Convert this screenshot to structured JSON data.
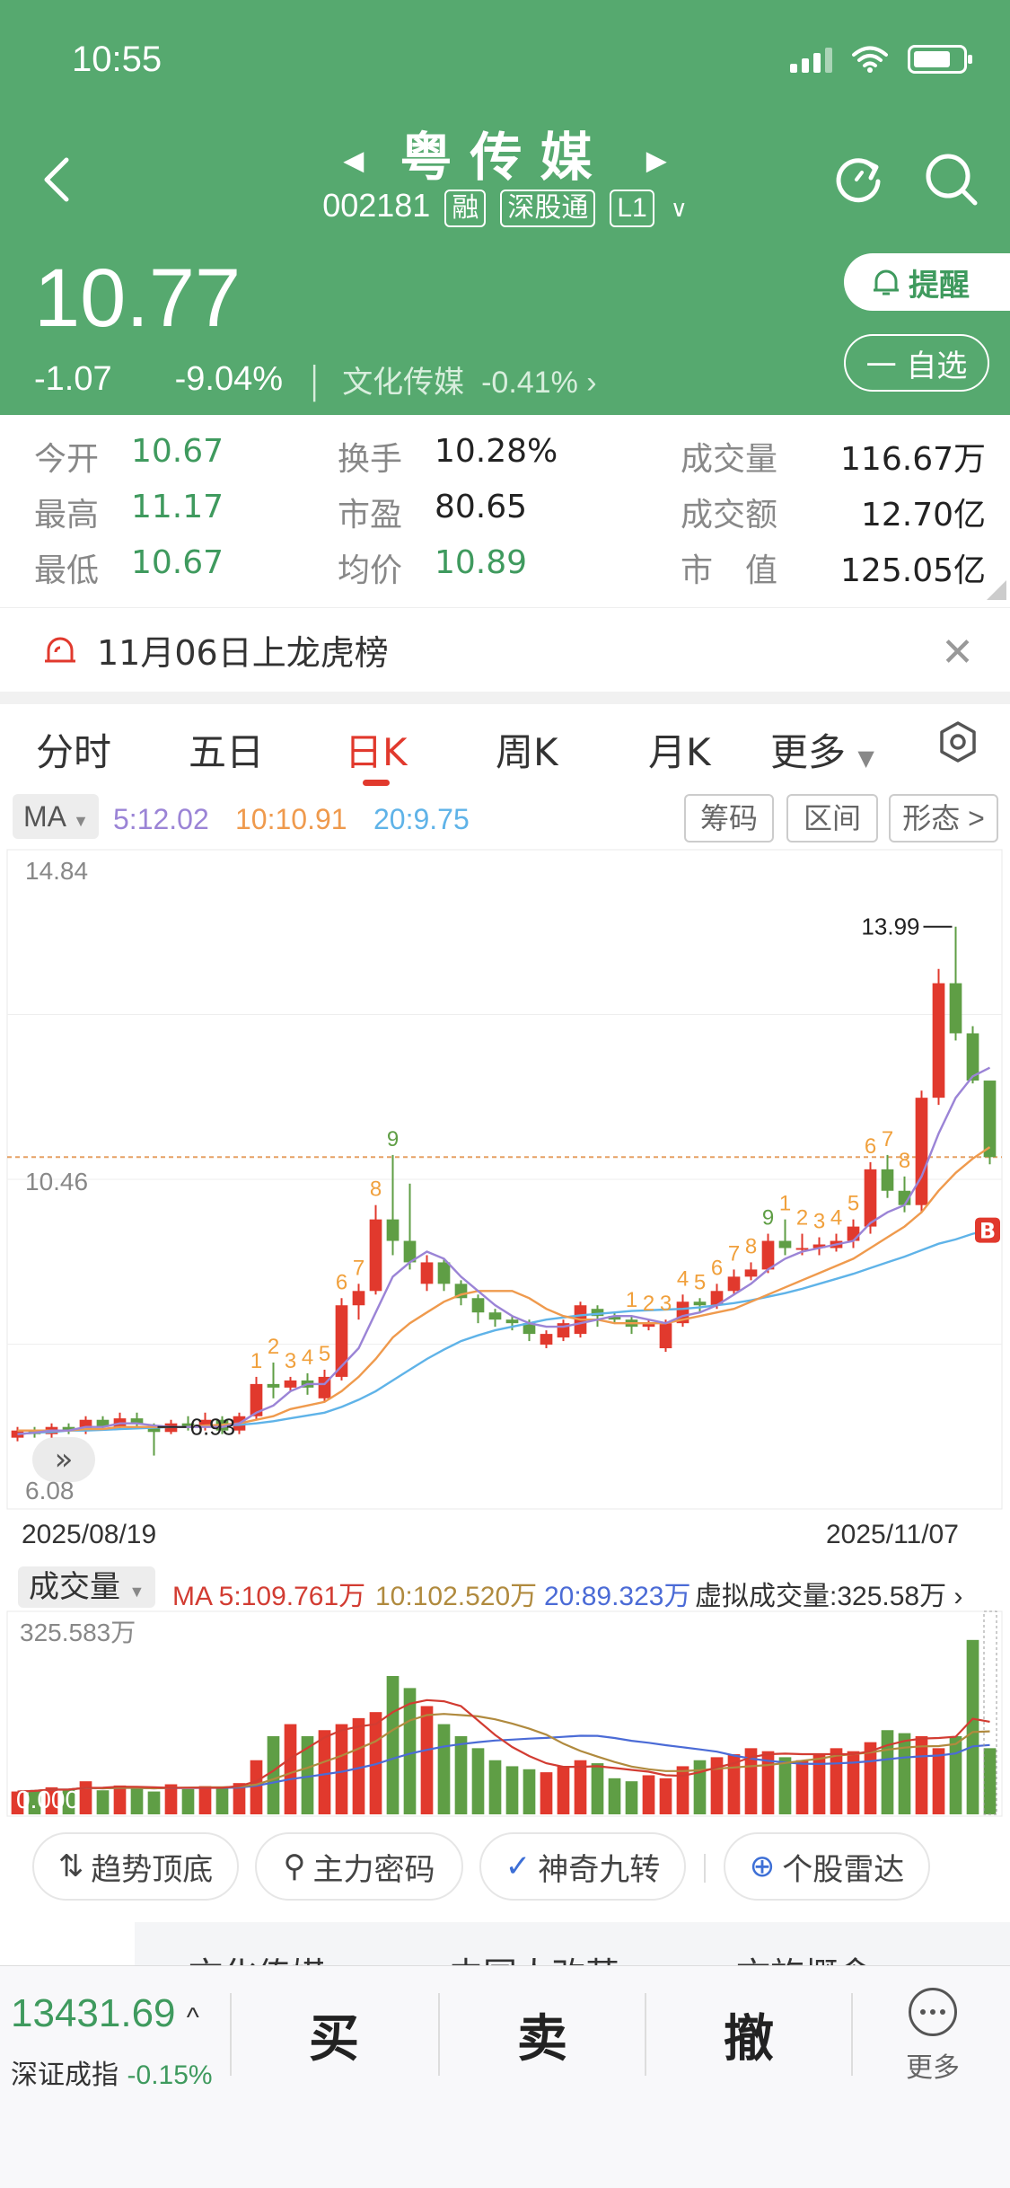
{
  "status": {
    "time": "10:55"
  },
  "header": {
    "title": "粤传媒",
    "code": "002181",
    "tags": [
      "融",
      "深股通",
      "L1"
    ]
  },
  "quote": {
    "price": "10.77",
    "change": "-1.07",
    "change_pct": "-9.04%",
    "sector": "文化传媒",
    "sector_pct": "-0.41%",
    "remind_label": "提醒",
    "watch_label": "一 自选"
  },
  "stats": {
    "open_label": "今开",
    "open": "10.67",
    "high_label": "最高",
    "high": "11.17",
    "low_label": "最低",
    "low": "10.67",
    "turnover_label": "换手",
    "turnover": "10.28%",
    "pe_label": "市盈",
    "pe": "80.65",
    "avg_label": "均价",
    "avg": "10.89",
    "volume_label": "成交量",
    "volume": "116.67万",
    "amount_label": "成交额",
    "amount": "12.70亿",
    "mktcap_label": "市　值",
    "mktcap": "125.05亿"
  },
  "notice": {
    "text": "11月06日上龙虎榜"
  },
  "tabs": [
    "分时",
    "五日",
    "日K",
    "周K",
    "月K",
    "更多"
  ],
  "active_tab": "日K",
  "ma": {
    "selector": "MA",
    "ma5": "5:12.02",
    "ma10": "10:10.91",
    "ma20": "20:9.75",
    "chips": [
      "筹码",
      "区间",
      "形态 >"
    ],
    "colors": {
      "ma5": "#9b84d6",
      "ma10": "#ef9a4d",
      "ma20": "#5fb3e8"
    }
  },
  "chart_data": {
    "type": "candlestick",
    "y_top": "14.84",
    "y_mid": "10.46",
    "y_bottom": "6.08",
    "ylim": [
      6.08,
      14.84
    ],
    "date_start": "2025/08/19",
    "date_end": "2025/11/07",
    "high_marker": "13.99",
    "low_marker": "6.93",
    "current_price_line": 10.77,
    "candles": [
      [
        6.85,
        6.95,
        7.0,
        6.8
      ],
      [
        6.95,
        6.9,
        7.0,
        6.85
      ],
      [
        6.9,
        7.0,
        7.05,
        6.85
      ],
      [
        7.0,
        6.95,
        7.05,
        6.9
      ],
      [
        6.95,
        7.1,
        7.15,
        6.9
      ],
      [
        7.1,
        7.0,
        7.15,
        6.95
      ],
      [
        7.0,
        7.12,
        7.2,
        6.98
      ],
      [
        7.12,
        7.05,
        7.2,
        7.0
      ],
      [
        7.0,
        6.93,
        7.05,
        6.6
      ],
      [
        6.93,
        7.05,
        7.1,
        6.9
      ],
      [
        7.05,
        7.0,
        7.15,
        6.95
      ],
      [
        7.0,
        7.1,
        7.2,
        6.95
      ],
      [
        7.1,
        6.95,
        7.15,
        6.9
      ],
      [
        6.95,
        7.15,
        7.2,
        6.9
      ],
      [
        7.15,
        7.6,
        7.7,
        7.1
      ],
      [
        7.6,
        7.55,
        7.9,
        7.4
      ],
      [
        7.55,
        7.65,
        7.7,
        7.5
      ],
      [
        7.65,
        7.55,
        7.75,
        7.45
      ],
      [
        7.4,
        7.7,
        7.8,
        7.35
      ],
      [
        7.7,
        8.7,
        8.8,
        7.65
      ],
      [
        8.7,
        8.9,
        9.0,
        8.5
      ],
      [
        8.9,
        9.9,
        10.1,
        8.85
      ],
      [
        9.9,
        9.6,
        10.8,
        9.4
      ],
      [
        9.6,
        9.3,
        10.4,
        9.2
      ],
      [
        9.0,
        9.3,
        9.4,
        8.9
      ],
      [
        9.3,
        9.0,
        9.35,
        8.9
      ],
      [
        9.0,
        8.8,
        9.05,
        8.7
      ],
      [
        8.8,
        8.6,
        8.85,
        8.45
      ],
      [
        8.6,
        8.5,
        8.65,
        8.4
      ],
      [
        8.5,
        8.45,
        8.55,
        8.35
      ],
      [
        8.45,
        8.3,
        8.5,
        8.2
      ],
      [
        8.15,
        8.3,
        8.35,
        8.1
      ],
      [
        8.25,
        8.45,
        8.5,
        8.2
      ],
      [
        8.3,
        8.7,
        8.75,
        8.25
      ],
      [
        8.65,
        8.55,
        8.7,
        8.4
      ],
      [
        8.55,
        8.5,
        8.6,
        8.45
      ],
      [
        8.5,
        8.4,
        8.55,
        8.3
      ],
      [
        8.4,
        8.45,
        8.5,
        8.35
      ],
      [
        8.1,
        8.45,
        8.5,
        8.05
      ],
      [
        8.45,
        8.75,
        8.85,
        8.4
      ],
      [
        8.75,
        8.7,
        8.8,
        8.6
      ],
      [
        8.7,
        8.9,
        9.0,
        8.65
      ],
      [
        8.9,
        9.1,
        9.2,
        8.85
      ],
      [
        9.1,
        9.2,
        9.3,
        9.05
      ],
      [
        9.2,
        9.6,
        9.7,
        9.15
      ],
      [
        9.6,
        9.5,
        9.9,
        9.4
      ],
      [
        9.5,
        9.5,
        9.7,
        9.4
      ],
      [
        9.5,
        9.55,
        9.65,
        9.4
      ],
      [
        9.5,
        9.6,
        9.7,
        9.45
      ],
      [
        9.6,
        9.8,
        9.9,
        9.5
      ],
      [
        9.8,
        10.6,
        10.7,
        9.7
      ],
      [
        10.6,
        10.3,
        10.8,
        10.2
      ],
      [
        10.3,
        10.1,
        10.5,
        10.0
      ],
      [
        10.1,
        11.6,
        11.7,
        10.0
      ],
      [
        11.6,
        13.2,
        13.4,
        11.5
      ],
      [
        13.2,
        12.5,
        13.99,
        12.4
      ],
      [
        12.5,
        11.84,
        12.6,
        11.8
      ],
      [
        11.84,
        10.77,
        11.17,
        10.67
      ]
    ],
    "ma5_line": [
      6.9,
      6.92,
      6.95,
      6.95,
      7.0,
      7.0,
      7.05,
      7.05,
      7.02,
      7.0,
      7.0,
      7.0,
      7.0,
      7.05,
      7.2,
      7.3,
      7.5,
      7.6,
      7.6,
      7.85,
      8.1,
      8.6,
      9.1,
      9.3,
      9.45,
      9.35,
      9.1,
      8.9,
      8.7,
      8.55,
      8.45,
      8.4,
      8.4,
      8.45,
      8.5,
      8.55,
      8.55,
      8.5,
      8.45,
      8.55,
      8.6,
      8.7,
      8.85,
      9.0,
      9.2,
      9.35,
      9.45,
      9.5,
      9.55,
      9.6,
      9.85,
      10.0,
      10.1,
      10.5,
      11.1,
      11.6,
      11.9,
      12.02
    ],
    "ma10_line": [
      6.95,
      6.95,
      6.95,
      6.95,
      6.97,
      6.97,
      7.0,
      7.0,
      7.0,
      7.0,
      7.0,
      7.02,
      7.03,
      7.05,
      7.1,
      7.15,
      7.25,
      7.3,
      7.35,
      7.5,
      7.7,
      7.95,
      8.25,
      8.45,
      8.6,
      8.75,
      8.85,
      8.9,
      8.9,
      8.9,
      8.8,
      8.65,
      8.55,
      8.5,
      8.5,
      8.45,
      8.45,
      8.45,
      8.45,
      8.5,
      8.55,
      8.6,
      8.65,
      8.75,
      8.85,
      8.95,
      9.05,
      9.15,
      9.25,
      9.35,
      9.5,
      9.65,
      9.8,
      10.0,
      10.3,
      10.55,
      10.75,
      10.91
    ],
    "ma20_line": [
      6.9,
      6.92,
      6.93,
      6.95,
      6.95,
      6.96,
      6.97,
      6.98,
      6.99,
      7.0,
      7.0,
      7.01,
      7.02,
      7.03,
      7.05,
      7.08,
      7.12,
      7.16,
      7.2,
      7.28,
      7.38,
      7.5,
      7.65,
      7.8,
      7.95,
      8.08,
      8.2,
      8.28,
      8.35,
      8.4,
      8.45,
      8.5,
      8.53,
      8.56,
      8.58,
      8.6,
      8.62,
      8.63,
      8.64,
      8.65,
      8.67,
      8.7,
      8.73,
      8.77,
      8.82,
      8.87,
      8.93,
      9.0,
      9.07,
      9.14,
      9.22,
      9.3,
      9.38,
      9.47,
      9.56,
      9.62,
      9.7,
      9.75
    ],
    "nine_turn": [
      {
        "i": 14,
        "n": "1"
      },
      {
        "i": 15,
        "n": "2"
      },
      {
        "i": 16,
        "n": "3"
      },
      {
        "i": 17,
        "n": "4"
      },
      {
        "i": 18,
        "n": "5"
      },
      {
        "i": 19,
        "n": "6"
      },
      {
        "i": 20,
        "n": "7"
      },
      {
        "i": 21,
        "n": "8"
      },
      {
        "i": 22,
        "n": "9"
      },
      {
        "i": 36,
        "n": "1"
      },
      {
        "i": 37,
        "n": "2"
      },
      {
        "i": 38,
        "n": "3"
      },
      {
        "i": 39,
        "n": "4"
      },
      {
        "i": 40,
        "n": "5"
      },
      {
        "i": 41,
        "n": "6"
      },
      {
        "i": 42,
        "n": "7"
      },
      {
        "i": 43,
        "n": "8"
      },
      {
        "i": 44,
        "n": "9"
      },
      {
        "i": 45,
        "n": "1"
      },
      {
        "i": 46,
        "n": "2"
      },
      {
        "i": 47,
        "n": "3"
      },
      {
        "i": 48,
        "n": "4"
      },
      {
        "i": 49,
        "n": "5"
      },
      {
        "i": 50,
        "n": "6"
      },
      {
        "i": 51,
        "n": "7"
      },
      {
        "i": 52,
        "n": "8"
      }
    ],
    "volume": {
      "label": "成交量",
      "ma5": "MA 5:109.761万",
      "ma10": "10:102.520万",
      "ma20": "20:89.323万",
      "virtual": "虚拟成交量:325.58万",
      "max_label": "325.583万",
      "zero_label": "0.000",
      "bars": [
        38,
        40,
        45,
        42,
        55,
        40,
        48,
        44,
        38,
        50,
        42,
        47,
        44,
        52,
        90,
        130,
        150,
        130,
        140,
        150,
        160,
        170,
        230,
        210,
        180,
        150,
        130,
        110,
        90,
        80,
        75,
        70,
        80,
        90,
        85,
        60,
        55,
        65,
        60,
        80,
        90,
        95,
        100,
        110,
        105,
        95,
        90,
        100,
        110,
        105,
        120,
        140,
        135,
        130,
        110,
        130,
        290,
        110
      ]
    }
  },
  "tools": [
    "趋势顶底",
    "主力密码",
    "神奇九转",
    "个股雷达"
  ],
  "peek": [
    "文化传媒",
    "中国人改革",
    "文旅概念"
  ],
  "bottom": {
    "index_value": "13431.69",
    "index_name": "深证成指",
    "index_pct": "-0.15%",
    "buy": "买",
    "sell": "卖",
    "cancel": "撤",
    "more": "更多"
  }
}
